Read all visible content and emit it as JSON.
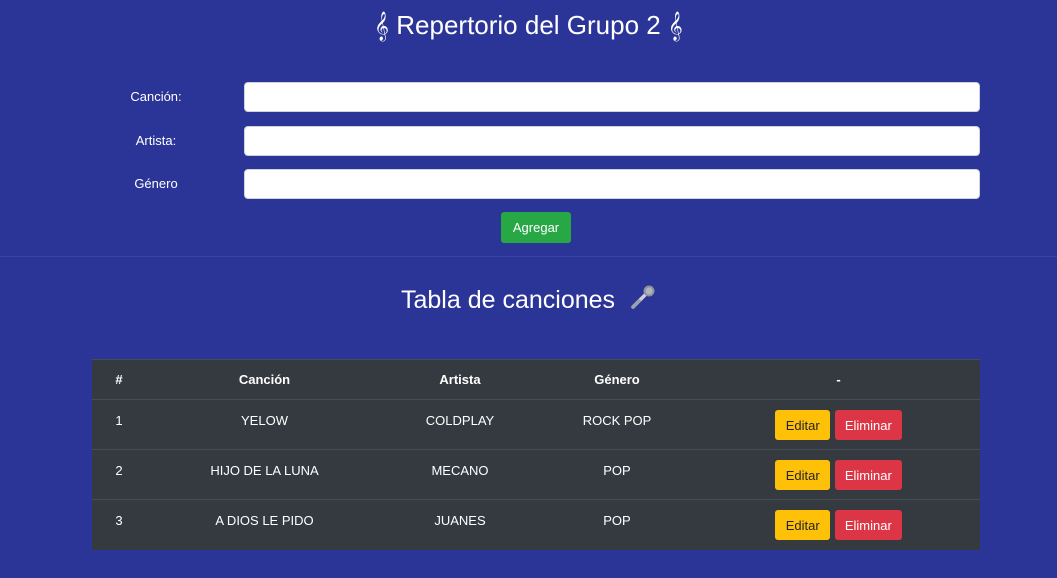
{
  "header": {
    "clef_left": "𝄞",
    "title": "Repertorio del Grupo 2",
    "clef_right": "𝄞"
  },
  "form": {
    "fields": [
      {
        "label": "Canción:",
        "value": ""
      },
      {
        "label": "Artista:",
        "value": ""
      },
      {
        "label": "Género",
        "value": ""
      }
    ],
    "submit_label": "Agregar"
  },
  "songs_section": {
    "title": "Tabla de canciones",
    "icon": "microphone-icon"
  },
  "table": {
    "headers": [
      "#",
      "Canción",
      "Artista",
      "Género",
      "-"
    ],
    "rows": [
      {
        "num": "1",
        "song": "YELOW",
        "artist": "COLDPLAY",
        "genre": "ROCK POP"
      },
      {
        "num": "2",
        "song": "HIJO DE LA LUNA",
        "artist": "MECANO",
        "genre": "POP"
      },
      {
        "num": "3",
        "song": "A DIOS LE PIDO",
        "artist": "JUANES",
        "genre": "POP"
      }
    ],
    "edit_label": "Editar",
    "delete_label": "Eliminar"
  },
  "colors": {
    "background": "#2b3497",
    "table_background": "#343a40",
    "add_button": "#28a745",
    "edit_button": "#ffc107",
    "delete_button": "#dc3545"
  }
}
